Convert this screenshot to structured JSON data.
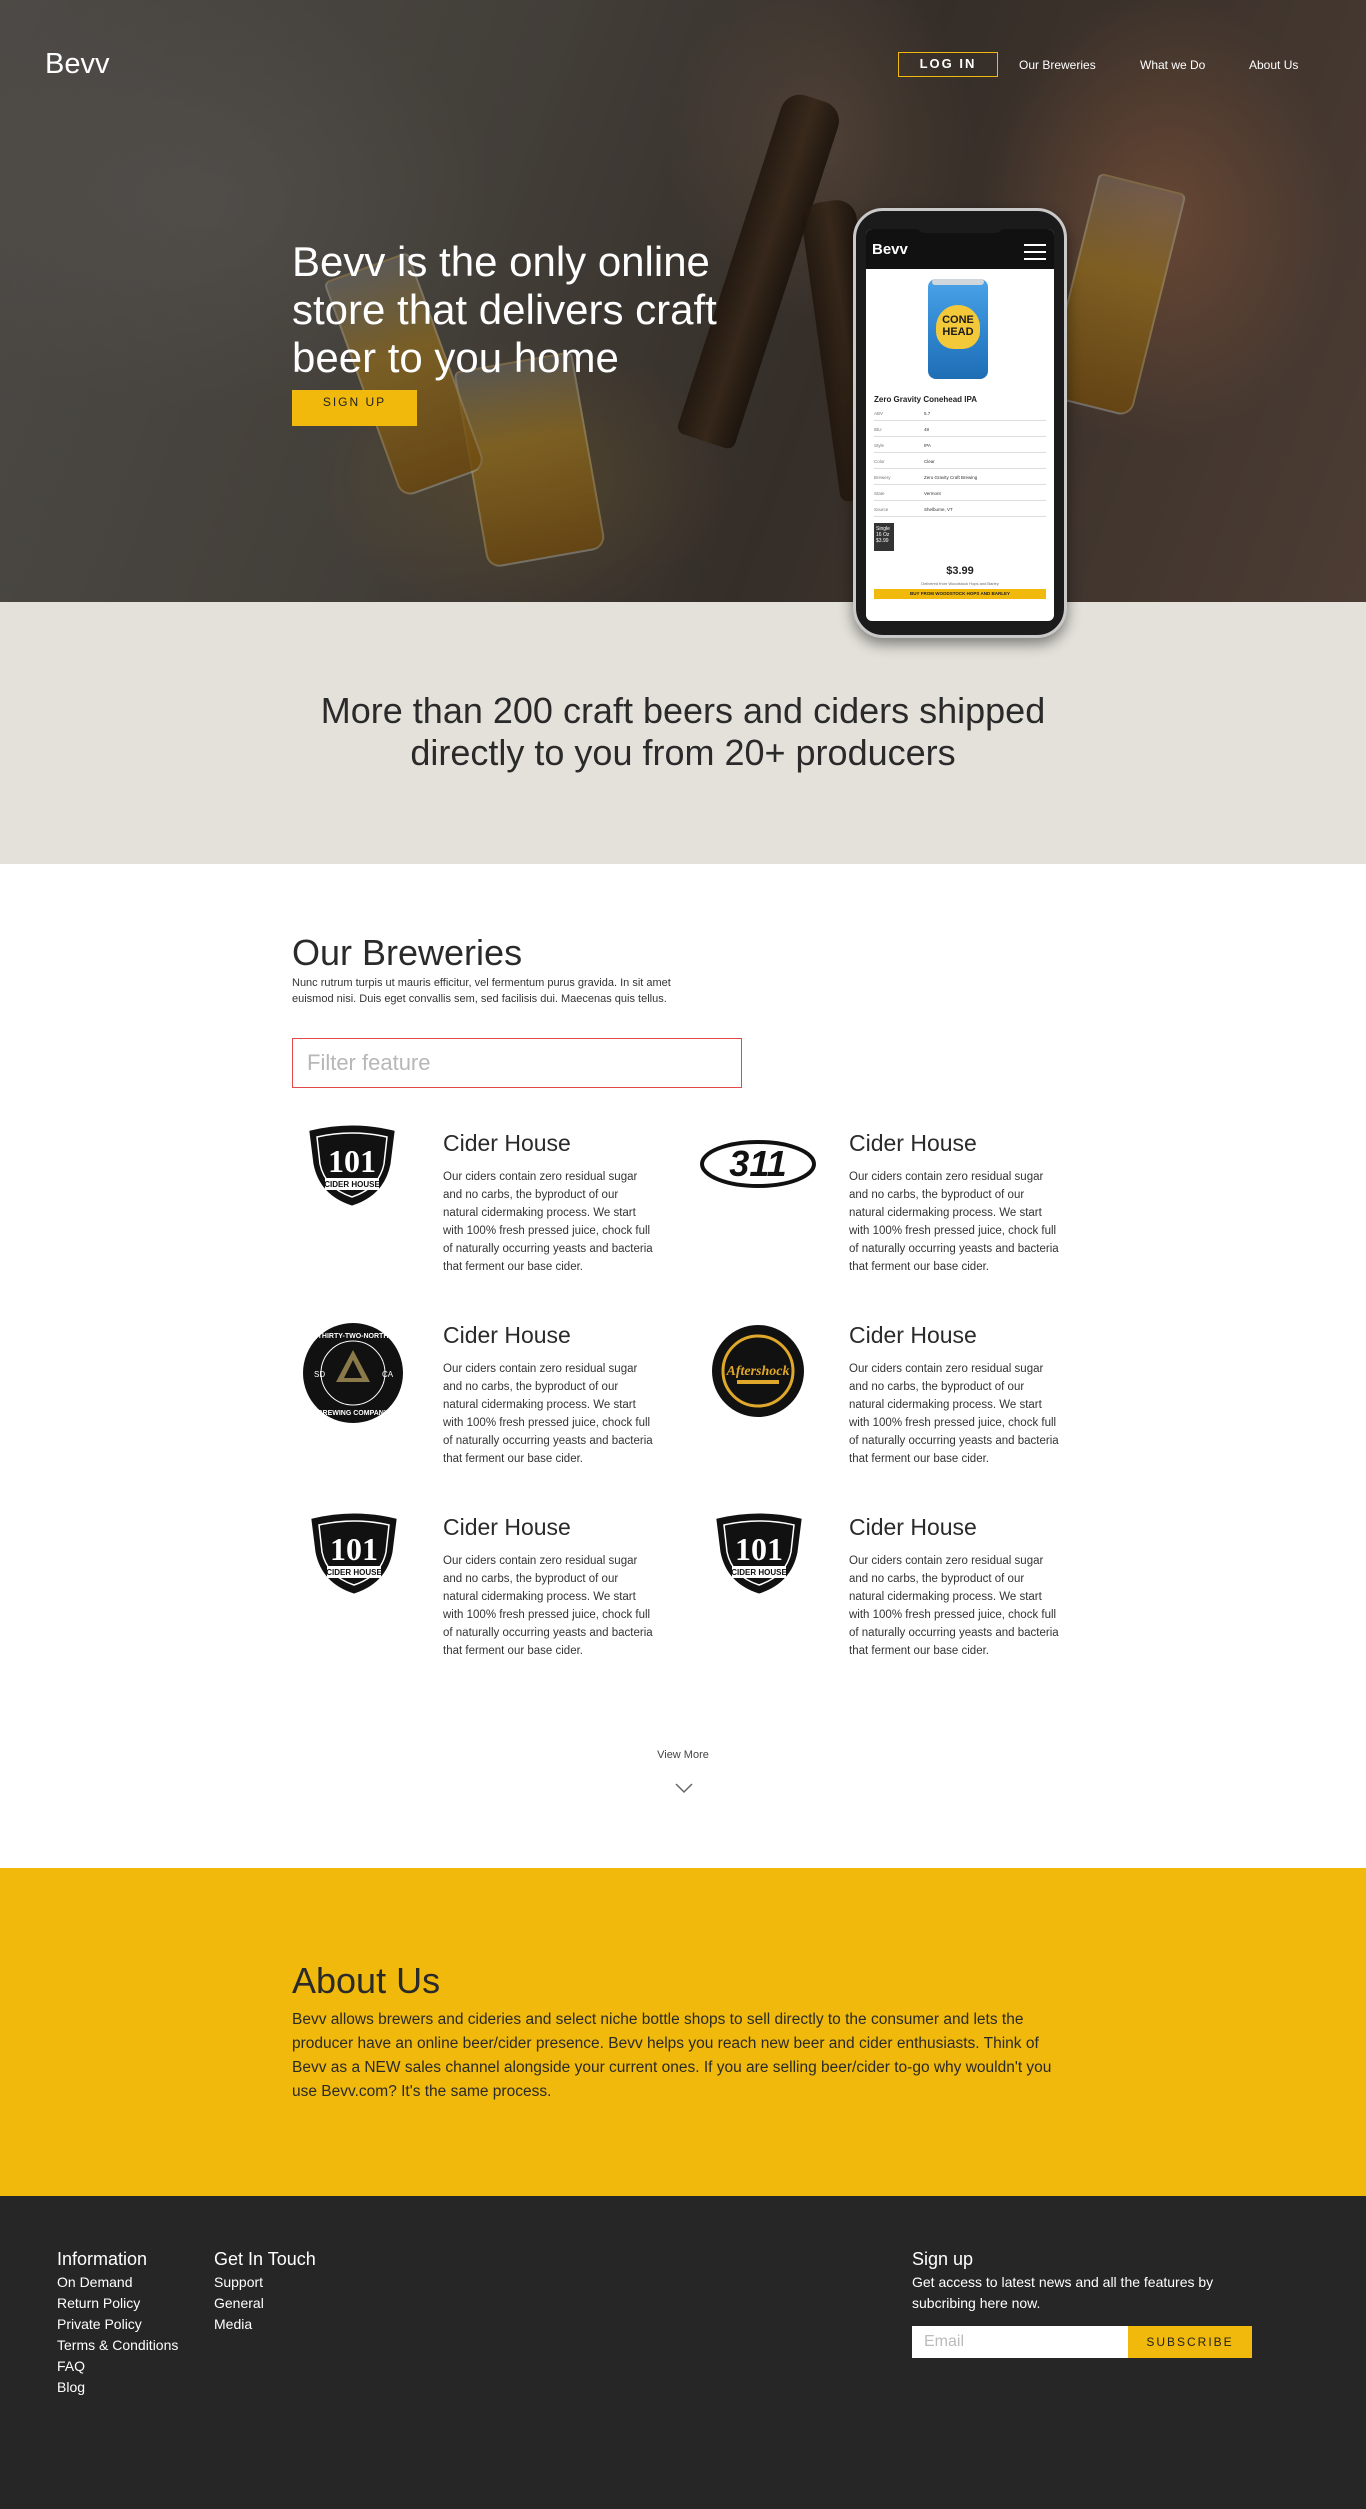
{
  "header": {
    "brand": "Bevv",
    "login_label": "LOG IN",
    "nav": [
      "Our Breweries",
      "What we Do",
      "About Us"
    ]
  },
  "hero": {
    "title": "Bevv is the only online store that delivers craft beer to you home",
    "signup_label": "SIGN UP"
  },
  "phone": {
    "brand": "Bevv",
    "can_label_line1": "CONE",
    "can_label_line2": "HEAD",
    "product_title": "Zero Gravity Conehead IPA",
    "specs": [
      {
        "k": "ABV",
        "v": "5.7"
      },
      {
        "k": "IBU",
        "v": "48"
      },
      {
        "k": "Style",
        "v": "IPA"
      },
      {
        "k": "Color",
        "v": "Clear"
      },
      {
        "k": "Brewery",
        "v": "Zero Gravity Craft Brewing"
      },
      {
        "k": "State",
        "v": "Vermont"
      },
      {
        "k": "Source",
        "v": "Shelburne, VT"
      }
    ],
    "chip_line1": "Single",
    "chip_line2": "16 Oz",
    "chip_line3": "$3.99",
    "price": "$3.99",
    "delivered": "Delivered from Woodstock Hops and Barley",
    "buy_label": "BUY FROM WOODSTOCK HOPS AND BARLEY"
  },
  "band": {
    "text": "More than 200 craft beers and ciders shipped directly to you from 20+ producers"
  },
  "breweries": {
    "title": "Our Breweries",
    "description": "Nunc rutrum turpis ut mauris efficitur, vel fermentum purus gravida. In sit amet euismod nisi. Duis eget convallis sem, sed facilisis dui. Maecenas quis tellus.",
    "filter_placeholder": "Filter feature",
    "cards": [
      {
        "title": "Cider House",
        "text": "Our ciders contain zero residual sugar and no carbs, the byproduct of our natural cidermaking process. We start with 100% fresh pressed juice, chock full of naturally occurring yeasts and bacteria that ferment our base cider.",
        "logo": "101-cider-house"
      },
      {
        "title": "Cider House",
        "text": "Our ciders contain zero residual sugar and no carbs, the byproduct of our natural cidermaking process. We start with 100% fresh pressed juice, chock full of naturally occurring yeasts and bacteria that ferment our base cider.",
        "logo": "311"
      },
      {
        "title": "Cider House",
        "text": "Our ciders contain zero residual sugar and no carbs, the byproduct of our natural cidermaking process. We start with 100% fresh pressed juice, chock full of naturally occurring yeasts and bacteria that ferment our base cider.",
        "logo": "thirty-two-north"
      },
      {
        "title": "Cider House",
        "text": "Our ciders contain zero residual sugar and no carbs, the byproduct of our natural cidermaking process. We start with 100% fresh pressed juice, chock full of naturally occurring yeasts and bacteria that ferment our base cider.",
        "logo": "aftershock"
      },
      {
        "title": "Cider House",
        "text": "Our ciders contain zero residual sugar and no carbs, the byproduct of our natural cidermaking process. We start with 100% fresh pressed juice, chock full of naturally occurring yeasts and bacteria that ferment our base cider.",
        "logo": "101-cider-house"
      },
      {
        "title": "Cider House",
        "text": "Our ciders contain zero residual sugar and no carbs, the byproduct of our natural cidermaking process. We start with 100% fresh pressed juice, chock full of naturally occurring yeasts and bacteria that ferment our base cider.",
        "logo": "101-cider-house"
      }
    ],
    "logo_text": {
      "one_o_one": "101",
      "cider_house": "CIDER HOUSE",
      "three_eleven": "311",
      "tn_top": "THIRTY-TWO-NORTH",
      "tn_bottom": "BREWING COMPANY",
      "tn_left": "SD",
      "tn_right": "CA",
      "aftershock": "Aftershock"
    },
    "view_more": "View More"
  },
  "about": {
    "title": "About Us",
    "text": "Bevv allows brewers and cideries and select niche bottle shops to sell directly to the consumer and lets the producer have an online beer/cider presence. Bevv helps you reach new beer and cider enthusiasts. Think of Bevv as a NEW sales channel alongside your current ones. If you are selling beer/cider to-go why wouldn't you use Bevv.com? It's the same process."
  },
  "footer": {
    "info_title": "Information",
    "info_links": [
      "On Demand",
      "Return Policy",
      "Private Policy",
      "Terms & Conditions",
      "FAQ",
      "Blog"
    ],
    "touch_title": "Get In Touch",
    "touch_links": [
      "Support",
      "General",
      "Media"
    ],
    "signup_title": "Sign up",
    "signup_text": "Get access to latest news and all the features by subcribing here now.",
    "email_placeholder": "Email",
    "subscribe_label": "SUBSCRIBE"
  },
  "colors": {
    "accent": "#f0b90b",
    "band": "#e3e1da",
    "footer": "#262626",
    "filter_border": "#e0484a"
  }
}
